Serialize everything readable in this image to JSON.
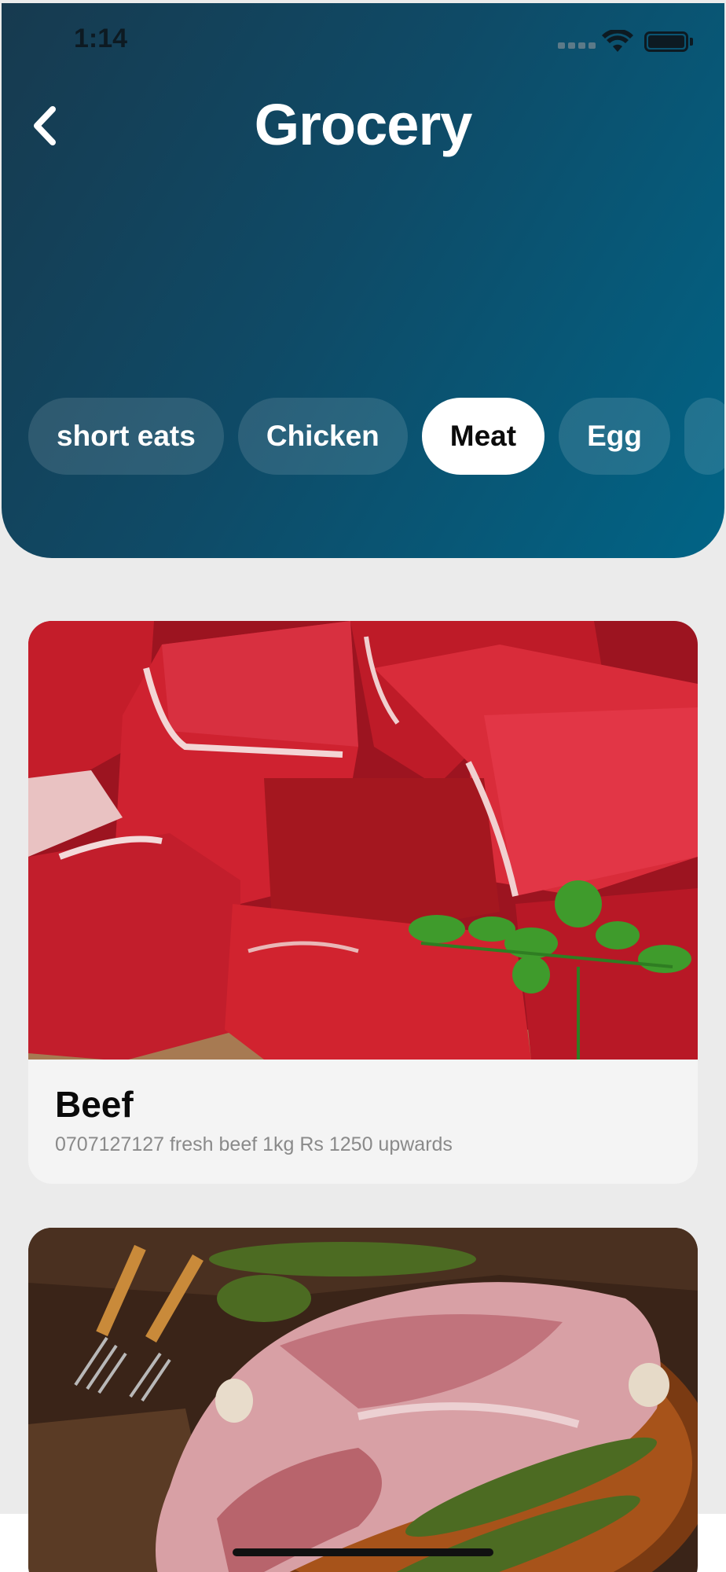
{
  "status_bar": {
    "time": "1:14"
  },
  "header": {
    "title": "Grocery"
  },
  "categories": [
    {
      "label": "short eats",
      "active": false
    },
    {
      "label": "Chicken",
      "active": false
    },
    {
      "label": "Meat",
      "active": true
    },
    {
      "label": "Egg",
      "active": false
    }
  ],
  "items": [
    {
      "title": "Beef",
      "description": "0707127127 fresh beef 1kg Rs 1250 upwards",
      "image": "raw-beef-cubes-photo"
    },
    {
      "title": "",
      "description": "",
      "image": "raw-lamb-leg-photo"
    }
  ],
  "colors": {
    "header_gradient_start": "#173a4f",
    "header_gradient_end": "#016486",
    "chip_active_bg": "#ffffff",
    "page_bg": "#ebebeb"
  }
}
